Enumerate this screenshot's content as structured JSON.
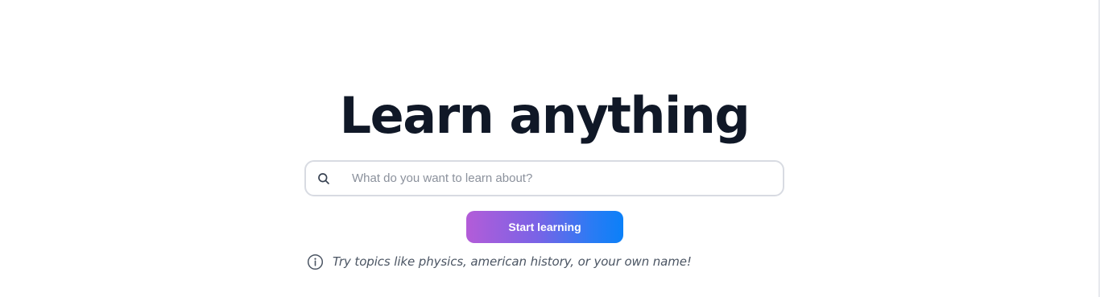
{
  "hero": {
    "title": "Learn anything"
  },
  "search": {
    "placeholder": "What do you want to learn about?",
    "value": "",
    "icon": "search-icon"
  },
  "actions": {
    "start_label": "Start learning"
  },
  "hint": {
    "icon": "info-icon",
    "text": "Try topics like physics, american history, or your own name!"
  },
  "colors": {
    "title": "#101827",
    "button_gradient_start": "#b35cd8",
    "button_gradient_end": "#0b80f8",
    "search_border": "#d8dbe2"
  }
}
